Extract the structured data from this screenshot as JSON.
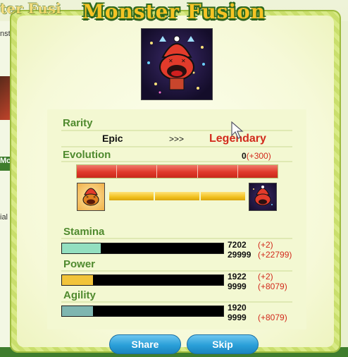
{
  "title": "Monster Fusion",
  "background": {
    "ghost_title": "ter Fusi",
    "frag_top": "nst",
    "frag_green": "Mo",
    "frag_mid": "ial"
  },
  "rarity": {
    "label": "Rarity",
    "from": "Epic",
    "arrows": ">>>",
    "to": "Legendary"
  },
  "evolution": {
    "label": "Evolution",
    "value": "0",
    "bonus": "(+300)",
    "segments": 5
  },
  "stats": [
    {
      "name": "Stamina",
      "current": "7202",
      "current_bonus": "(+2)",
      "max": "29999",
      "max_bonus": "(+22799)",
      "fill_fraction": 0.24,
      "fill_color": "#93dfc0"
    },
    {
      "name": "Power",
      "current": "1922",
      "current_bonus": "(+2)",
      "max": "9999",
      "max_bonus": "(+8079)",
      "fill_fraction": 0.19,
      "fill_color": "#f2c43a"
    },
    {
      "name": "Agility",
      "current": "1920",
      "current_bonus": "",
      "max": "9999",
      "max_bonus": "(+8079)",
      "fill_fraction": 0.19,
      "fill_color": "#7fb6b0"
    }
  ],
  "buttons": {
    "share": "Share",
    "skip": "Skip"
  }
}
